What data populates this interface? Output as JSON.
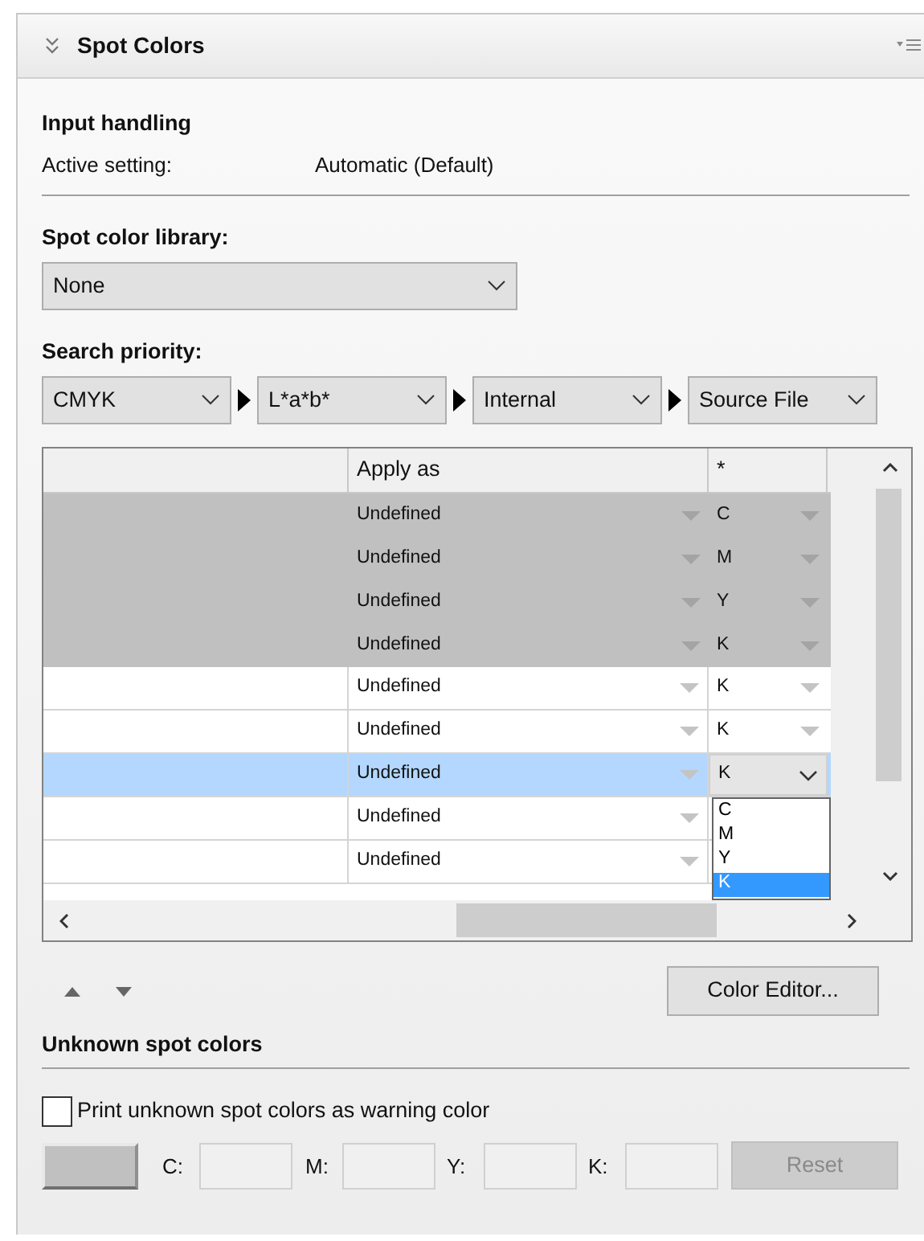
{
  "panel": {
    "title": "Spot Colors"
  },
  "input_handling": {
    "heading": "Input handling",
    "label": "Active setting:",
    "value": "Automatic (Default)"
  },
  "library": {
    "label": "Spot color library:",
    "value": "None"
  },
  "search_priority": {
    "label": "Search priority:",
    "options": [
      {
        "value": "CMYK"
      },
      {
        "value": "L*a*b*"
      },
      {
        "value": "Internal"
      },
      {
        "value": "Source File"
      }
    ]
  },
  "table": {
    "columns": [
      "Apply as",
      "*"
    ],
    "rows": [
      {
        "apply_as": "Undefined",
        "channel": "C",
        "disabled": true,
        "selected": false,
        "expanded": false
      },
      {
        "apply_as": "Undefined",
        "channel": "M",
        "disabled": true,
        "selected": false,
        "expanded": false
      },
      {
        "apply_as": "Undefined",
        "channel": "Y",
        "disabled": true,
        "selected": false,
        "expanded": false
      },
      {
        "apply_as": "Undefined",
        "channel": "K",
        "disabled": true,
        "selected": false,
        "expanded": false
      },
      {
        "apply_as": "Undefined",
        "channel": "K",
        "disabled": false,
        "selected": false,
        "expanded": false
      },
      {
        "apply_as": "Undefined",
        "channel": "K",
        "disabled": false,
        "selected": false,
        "expanded": false
      },
      {
        "apply_as": "Undefined",
        "channel": "K",
        "disabled": false,
        "selected": true,
        "expanded": true
      },
      {
        "apply_as": "Undefined",
        "channel": "",
        "disabled": false,
        "selected": false,
        "expanded": false
      },
      {
        "apply_as": "Undefined",
        "channel": "",
        "disabled": false,
        "selected": false,
        "expanded": false
      }
    ],
    "dropdown_options": [
      {
        "label": "C",
        "selected": false
      },
      {
        "label": "M",
        "selected": false
      },
      {
        "label": "Y",
        "selected": false
      },
      {
        "label": "K",
        "selected": true
      }
    ]
  },
  "color_editor_button": "Color Editor...",
  "unknown": {
    "heading": "Unknown spot colors",
    "checkbox": {
      "label": "Print unknown spot colors as warning color",
      "checked": false
    },
    "fields": [
      {
        "label": "C:"
      },
      {
        "label": "M:"
      },
      {
        "label": "Y:"
      },
      {
        "label": "K:"
      }
    ],
    "reset": {
      "label": "Reset",
      "disabled": true
    }
  }
}
